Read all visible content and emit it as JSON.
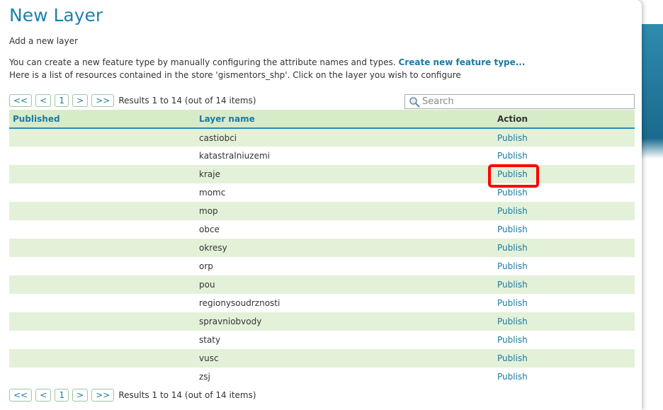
{
  "page": {
    "title": "New Layer",
    "subtitle": "Add a new layer",
    "intro_text": "You can create a new feature type by manually configuring the attribute names and types.",
    "create_link": "Create new feature type...",
    "store_text": "Here is a list of resources contained in the store 'gismentors_shp'. Click on the layer you wish to configure"
  },
  "pager": {
    "first": "<<",
    "prev": "<",
    "page": "1",
    "next": ">",
    "last": ">>",
    "info": "Results 1 to 14 (out of 14 items)"
  },
  "search": {
    "placeholder": "Search",
    "icon": "magnifier-icon"
  },
  "table": {
    "headers": {
      "published": "Published",
      "layer_name": "Layer name",
      "action": "Action"
    },
    "rows": [
      {
        "published": "",
        "name": "castiobci",
        "action": "Publish"
      },
      {
        "published": "",
        "name": "katastralniuzemi",
        "action": "Publish"
      },
      {
        "published": "",
        "name": "kraje",
        "action": "Publish"
      },
      {
        "published": "",
        "name": "momc",
        "action": "Publish"
      },
      {
        "published": "",
        "name": "mop",
        "action": "Publish"
      },
      {
        "published": "",
        "name": "obce",
        "action": "Publish"
      },
      {
        "published": "",
        "name": "okresy",
        "action": "Publish"
      },
      {
        "published": "",
        "name": "orp",
        "action": "Publish"
      },
      {
        "published": "",
        "name": "pou",
        "action": "Publish"
      },
      {
        "published": "",
        "name": "regionysoudrznosti",
        "action": "Publish"
      },
      {
        "published": "",
        "name": "spravniobvody",
        "action": "Publish"
      },
      {
        "published": "",
        "name": "staty",
        "action": "Publish"
      },
      {
        "published": "",
        "name": "vusc",
        "action": "Publish"
      },
      {
        "published": "",
        "name": "zsj",
        "action": "Publish"
      }
    ]
  },
  "colors": {
    "title": "#1b83a8",
    "link": "#1b7aa3",
    "header_bg": "#d7ebc9",
    "row_alt": "#e3f1d9",
    "highlight": "#ff0000"
  }
}
